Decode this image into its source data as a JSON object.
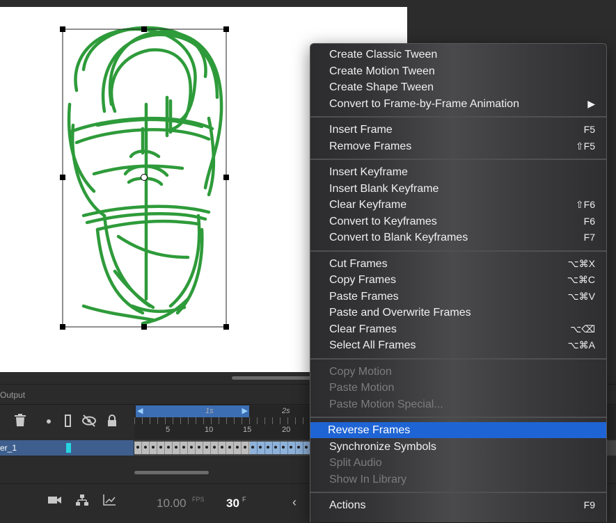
{
  "timeline": {
    "output_tab": "Output",
    "layer_name": "er_1",
    "ruler": {
      "span_label": "1s",
      "next_label": "2s",
      "frame_numbers": [
        "5",
        "10",
        "15",
        "20"
      ]
    },
    "fps_value": "10.00",
    "fps_unit": "FPS",
    "frame_value": "30",
    "frame_unit": "F"
  },
  "icons": {
    "delete": "trash-icon",
    "dot": "dot-icon",
    "outline": "outline-icon",
    "visibility": "eye-slash-icon",
    "lock": "lock-icon",
    "camera": "camera-icon",
    "parent": "hierarchy-icon",
    "graph": "graph-icon",
    "prev": "chevron-left-icon"
  },
  "colors": {
    "drawing": "#2e9b3a",
    "menu_highlight": "#1f64d4",
    "layer_highlight": "#3e5f8e"
  },
  "menu": {
    "groups": [
      [
        {
          "label": "Create Classic Tween",
          "shortcut": ""
        },
        {
          "label": "Create Motion Tween",
          "shortcut": ""
        },
        {
          "label": "Create Shape Tween",
          "shortcut": ""
        },
        {
          "label": "Convert to Frame-by-Frame Animation",
          "shortcut": "▶"
        }
      ],
      [
        {
          "label": "Insert Frame",
          "shortcut": "F5"
        },
        {
          "label": "Remove Frames",
          "shortcut": "⇧F5"
        }
      ],
      [
        {
          "label": "Insert Keyframe",
          "shortcut": ""
        },
        {
          "label": "Insert Blank Keyframe",
          "shortcut": ""
        },
        {
          "label": "Clear Keyframe",
          "shortcut": "⇧F6"
        },
        {
          "label": "Convert to Keyframes",
          "shortcut": "F6"
        },
        {
          "label": "Convert to Blank Keyframes",
          "shortcut": "F7"
        }
      ],
      [
        {
          "label": "Cut Frames",
          "shortcut": "⌥⌘X"
        },
        {
          "label": "Copy Frames",
          "shortcut": "⌥⌘C"
        },
        {
          "label": "Paste Frames",
          "shortcut": "⌥⌘V"
        },
        {
          "label": "Paste and Overwrite Frames",
          "shortcut": ""
        },
        {
          "label": "Clear Frames",
          "shortcut": "⌥⌫"
        },
        {
          "label": "Select All Frames",
          "shortcut": "⌥⌘A"
        }
      ],
      [
        {
          "label": "Copy Motion",
          "shortcut": "",
          "disabled": true
        },
        {
          "label": "Paste Motion",
          "shortcut": "",
          "disabled": true
        },
        {
          "label": "Paste Motion Special...",
          "shortcut": "",
          "disabled": true
        }
      ],
      [
        {
          "label": "Reverse Frames",
          "shortcut": "",
          "highlighted": true
        },
        {
          "label": "Synchronize Symbols",
          "shortcut": ""
        },
        {
          "label": "Split Audio",
          "shortcut": "",
          "disabled": true
        },
        {
          "label": "Show In Library",
          "shortcut": "",
          "disabled": true
        }
      ],
      [
        {
          "label": "Actions",
          "shortcut": "F9"
        }
      ]
    ]
  }
}
